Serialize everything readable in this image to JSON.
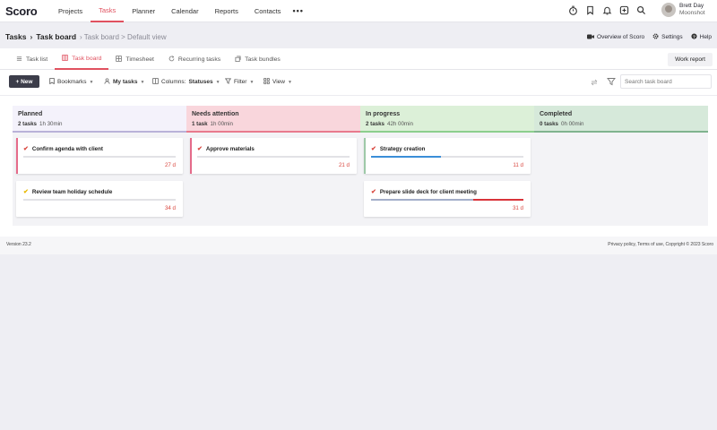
{
  "app": {
    "logo": "Scoro"
  },
  "nav": {
    "items": [
      "Projects",
      "Tasks",
      "Planner",
      "Calendar",
      "Reports",
      "Contacts"
    ],
    "active": "Tasks",
    "more": "•••"
  },
  "user": {
    "name": "Brett Day",
    "company": "Moonshot"
  },
  "breadcrumb": {
    "root": "Tasks",
    "sep": "›",
    "current": "Task board",
    "sub": "› Task board > Default view"
  },
  "header_links": {
    "overview": "Overview of Scoro",
    "settings": "Settings",
    "help": "Help"
  },
  "tabs": [
    {
      "label": "Task list",
      "icon": "list-icon"
    },
    {
      "label": "Task board",
      "icon": "board-icon"
    },
    {
      "label": "Timesheet",
      "icon": "grid-icon"
    },
    {
      "label": "Recurring tasks",
      "icon": "refresh-icon"
    },
    {
      "label": "Task bundles",
      "icon": "bundle-icon"
    }
  ],
  "active_tab": "Task board",
  "work_report": "Work report",
  "toolbar": {
    "new": "+ New",
    "bookmarks": "Bookmarks",
    "mytasks": "My tasks",
    "columns_prefix": "Columns:",
    "columns_value": "Statuses",
    "filter": "Filter",
    "view": "View",
    "search_placeholder": "Search task board"
  },
  "columns": [
    {
      "title": "Planned",
      "count": "2 tasks",
      "time": "1h 30min",
      "color": "#b9b2d8",
      "bg": "#f4f2fb",
      "cards": [
        {
          "title": "Confirm agenda with client",
          "due": "27 d",
          "check_color": "#d9473f",
          "bar": "#e56b8a"
        },
        {
          "title": "Review team holiday schedule",
          "due": "34 d",
          "check_color": "#e8b800",
          "bar": ""
        }
      ]
    },
    {
      "title": "Needs attention",
      "count": "1 task",
      "time": "1h 00min",
      "color": "#e87a8d",
      "bg": "#f9d6dc",
      "cards": [
        {
          "title": "Approve materials",
          "due": "21 d",
          "check_color": "#d9473f",
          "bar": "#e56b8a"
        }
      ]
    },
    {
      "title": "In progress",
      "count": "2 tasks",
      "time": "42h 00min",
      "color": "#8ccf8d",
      "bg": "#dcf0d8",
      "cards": [
        {
          "title": "Strategy creation",
          "due": "11 d",
          "check_color": "#d9473f",
          "bar": "#9ec9a8",
          "progress": 0.46,
          "progress_color": "#3b8ed8"
        },
        {
          "title": "Prepare slide deck for client meeting",
          "due": "31 d",
          "check_color": "#d9473f",
          "bar": "",
          "progress": 0.67,
          "progress_color": "#a3aec9",
          "overdue": 0.33,
          "overdue_color": "#d9333a"
        }
      ]
    },
    {
      "title": "Completed",
      "count": "0 tasks",
      "time": "0h 00min",
      "color": "#7fb38e",
      "bg": "#d6e9da",
      "cards": []
    }
  ],
  "footer": {
    "version": "Version 23.2",
    "legal": "Privacy policy, Terms of use, Copyright © 2023 Scoro"
  }
}
